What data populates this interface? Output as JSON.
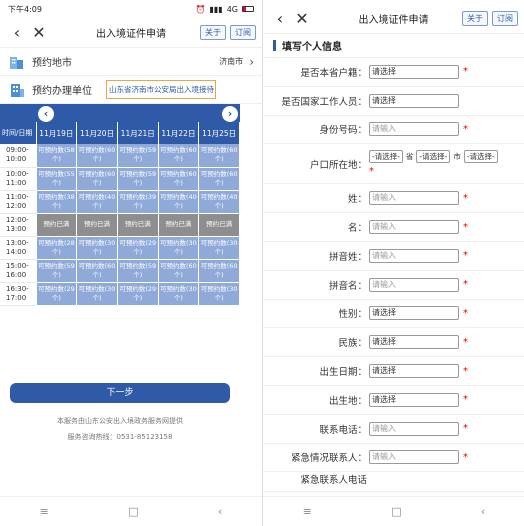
{
  "left": {
    "status": {
      "time": "下午4:09",
      "net": "4G"
    },
    "title": "出入境证件申请",
    "btn_about": "关于",
    "btn_order": "订阅",
    "place": {
      "label": "预约地市",
      "value": "济南市"
    },
    "unit": {
      "label": "预约办理单位",
      "value": "山东省济南市公安局出入境接待"
    },
    "table": {
      "corner": "时间/日期",
      "dates": [
        "11月19日",
        "11月20日",
        "11月21日",
        "11月22日",
        "11月25日"
      ],
      "rows": [
        {
          "time": "09:00-10:00",
          "cells": [
            "可预约数(58个)",
            "可预约数(60个)",
            "可预约数(59个)",
            "可预约数(60个)",
            "可预约数(60个)"
          ]
        },
        {
          "time": "10:00-11:00",
          "cells": [
            "可预约数(55个)",
            "可预约数(60个)",
            "可预约数(59个)",
            "可预约数(60个)",
            "可预约数(60个)"
          ]
        },
        {
          "time": "11:00-12:00",
          "cells": [
            "可预约数(38个)",
            "可预约数(40个)",
            "可预约数(39个)",
            "可预约数(40个)",
            "可预约数(40个)"
          ]
        },
        {
          "time": "12:00-13:00",
          "full": true,
          "cells": [
            "预约已满",
            "预约已满",
            "预约已满",
            "预约已满",
            "预约已满"
          ]
        },
        {
          "time": "13:00-14:00",
          "cells": [
            "可预约数(28个)",
            "可预约数(30个)",
            "可预约数(29个)",
            "可预约数(30个)",
            "可预约数(30个)"
          ]
        },
        {
          "time": "15:00-16:00",
          "cells": [
            "可预约数(59个)",
            "可预约数(60个)",
            "可预约数(59个)",
            "可预约数(60个)",
            "可预约数(60个)"
          ]
        },
        {
          "time": "16:30-17:00",
          "cells": [
            "可预约数(29个)",
            "可预约数(30个)",
            "可预约数(29个)",
            "可预约数(30个)",
            "可预约数(30个)"
          ]
        }
      ]
    },
    "next": "下一步",
    "footer1": "本服务由山东公安出入境政务服务网提供",
    "footer2": "服务咨询热线：0531-85123158"
  },
  "right": {
    "title": "出入境证件申请",
    "btn_about": "关于",
    "btn_order": "订阅",
    "section": "填写个人信息",
    "fields": [
      {
        "label": "是否本省户籍：",
        "value": "请选择",
        "placeholder": false,
        "required": true
      },
      {
        "label": "是否国家工作人员：",
        "value": "请选择",
        "placeholder": false,
        "required": false
      },
      {
        "label": "身份号码：",
        "value": "请输入",
        "placeholder": true,
        "required": true
      }
    ],
    "hukou": {
      "label": "户口所在地：",
      "prov": "-请选择-",
      "prov_unit": "省",
      "city": "-请选择-",
      "city_unit": "市",
      "county": "-请选择-"
    },
    "fields2": [
      {
        "label": "姓：",
        "value": "请输入",
        "placeholder": true,
        "required": true
      },
      {
        "label": "名：",
        "value": "请输入",
        "placeholder": true,
        "required": true
      },
      {
        "label": "拼音姓：",
        "value": "请输入",
        "placeholder": true,
        "required": true
      },
      {
        "label": "拼音名：",
        "value": "请输入",
        "placeholder": true,
        "required": true
      },
      {
        "label": "性别：",
        "value": "请选择",
        "placeholder": false,
        "required": true
      },
      {
        "label": "民族：",
        "value": "请选择",
        "placeholder": false,
        "required": true
      },
      {
        "label": "出生日期：",
        "value": "请选择",
        "placeholder": false,
        "required": true
      },
      {
        "label": "出生地：",
        "value": "请选择",
        "placeholder": false,
        "required": true
      },
      {
        "label": "联系电话：",
        "value": "请输入",
        "placeholder": true,
        "required": true
      },
      {
        "label": "紧急情况联系人：",
        "value": "请输入",
        "placeholder": true,
        "required": true
      }
    ],
    "cut_label": "紧急联系人电话"
  },
  "sys": {
    "menu": "≡",
    "home": "□",
    "back": "‹"
  }
}
